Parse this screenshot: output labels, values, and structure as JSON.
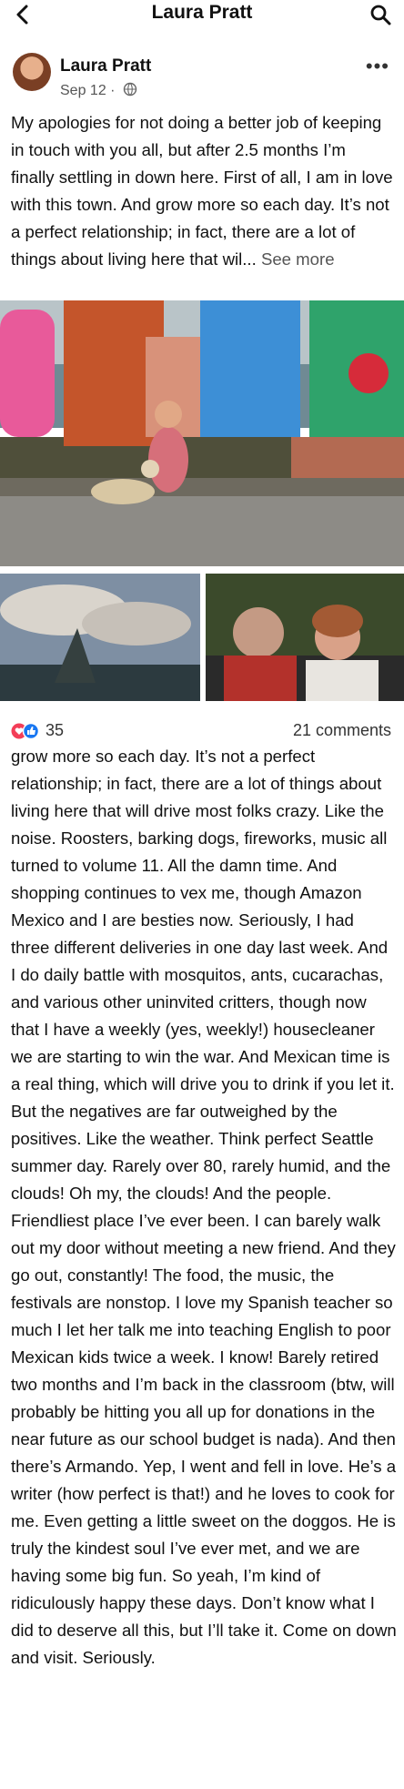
{
  "header": {
    "title": "Laura Pratt",
    "back_icon": "back-arrow-icon",
    "search_icon": "search-icon"
  },
  "post": {
    "author": "Laura Pratt",
    "date": "Sep 12",
    "audience_icon": "globe-icon",
    "options_icon": "more-dots-icon",
    "text_preview": "My apologies for not doing a better job of keeping in touch with you all, but after 2.5 months I’m finally settling in down here. First of all, I am in love with this town. And grow more so each day. It’s not a perfect relationship; in fact, there are a lot of things about living here that wil...",
    "see_more": "See more",
    "reaction_count": "35",
    "comments": "21 comments",
    "continued_text": "grow more so each day. It’s not a perfect relationship; in fact, there are a lot of things about living here that will drive most folks crazy. Like the noise. Roosters, barking dogs, fireworks, music all turned to volume 11. All the damn time. And shopping continues to vex me, though Amazon Mexico and I are besties now. Seriously, I had three different deliveries in one day last week. And I do daily battle with mosquitos, ants, cucarachas, and various other uninvited critters, though now that I have a weekly (yes, weekly!) housecleaner we are starting to win the war. And Mexican time is a real thing, which will drive you to drink if you let it. But the negatives are far outweighed by the positives. Like the weather. Think perfect Seattle summer day. Rarely over 80, rarely humid, and the clouds! Oh my, the clouds! And the people. Friendliest place I’ve ever been. I can barely walk out my door without meeting a new friend. And they go out, constantly! The food, the music, the festivals are nonstop. I love my Spanish teacher so much I let her talk me into teaching English to poor Mexican kids twice a week. I know! Barely retired two months and I’m back in the classroom (btw, will probably be hitting you all up for donations in the near future as our school budget is nada). And then there’s Armando. Yep, I went and fell in love. He’s a writer (how perfect is that!) and he loves to cook for me. Even getting a little sweet on the doggos. He is truly the kindest soul I’ve ever met, and we are having some big fun. So yeah, I’m kind of ridiculously happy these days. Don’t know what I did to deserve all this, but I’ll take it. Come on down and visit. Seriously."
  },
  "colors": {
    "like_blue": "#1877f2",
    "love_red": "#f33e58",
    "muted": "#555555"
  }
}
